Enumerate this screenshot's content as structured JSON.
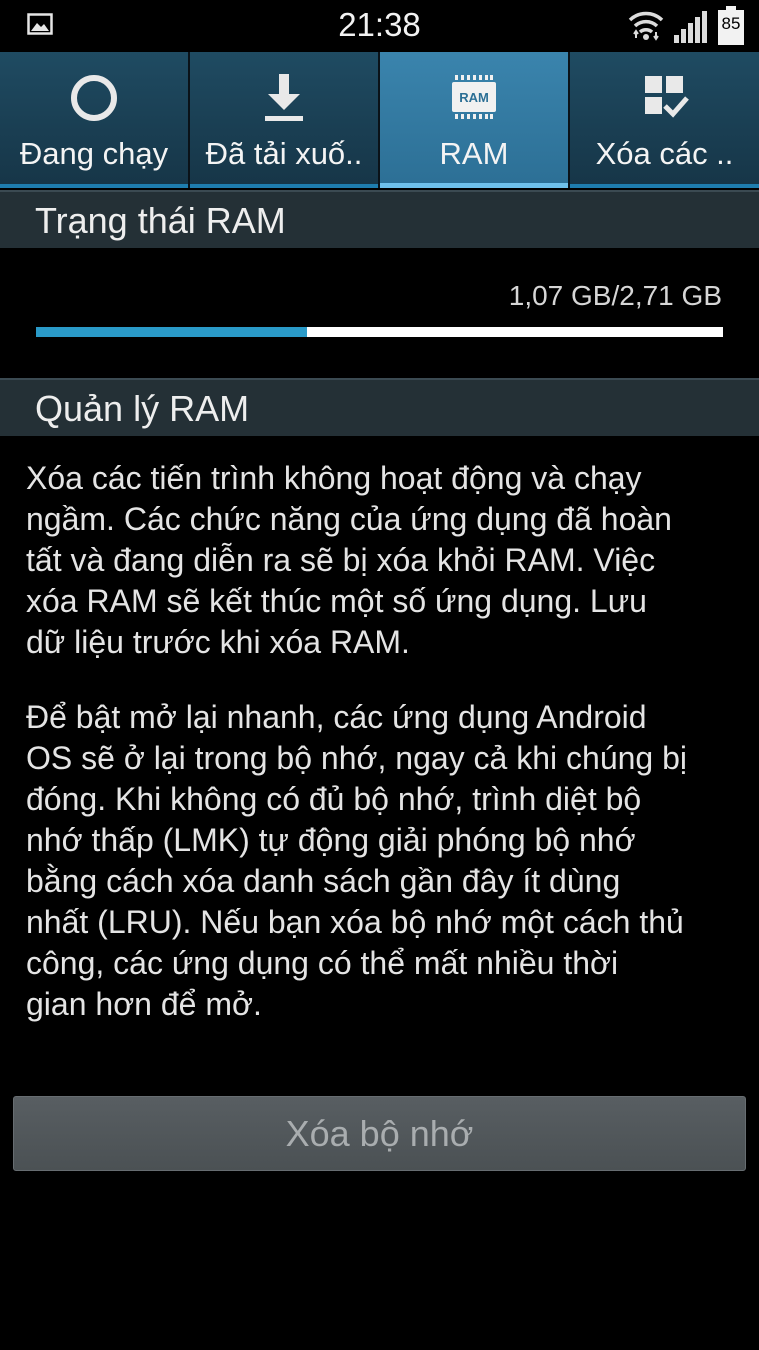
{
  "status_bar": {
    "time": "21:38",
    "battery_level": "85",
    "icons": [
      "gallery-icon",
      "wifi-icon",
      "signal-icon",
      "battery-icon"
    ]
  },
  "tabs": [
    {
      "label": "Đang chạy",
      "icon": "progress-ring-icon",
      "active": false
    },
    {
      "label": "Đã tải xuố..",
      "icon": "download-icon",
      "active": false
    },
    {
      "label": "RAM",
      "icon": "ram-chip-icon",
      "active": true
    },
    {
      "label": "Xóa các ..",
      "icon": "clear-check-icon",
      "active": false
    }
  ],
  "ram_status": {
    "title": "Trạng thái RAM",
    "usage_text": "1,07 GB/2,71 GB",
    "used_fraction": 0.395
  },
  "ram_manage": {
    "title": "Quản lý RAM",
    "paragraph_1": "Xóa các tiến trình không hoạt động và chạy\nngầm. Các chức năng của ứng dụng đã hoàn\ntất và đang diễn ra sẽ bị xóa khỏi RAM. Việc\nxóa RAM sẽ kết thúc một số ứng dụng. Lưu\ndữ liệu trước khi xóa RAM.",
    "paragraph_2": "Để bật mở lại nhanh, các ứng dụng Android\nOS sẽ ở lại trong bộ nhớ, ngay cả khi chúng bị\nđóng. Khi không có đủ bộ nhớ, trình diệt bộ\nnhớ thấp (LMK) tự động giải phóng bộ nhớ\nbằng cách xóa danh sách gần đây ít dùng\nnhất (LRU). Nếu bạn xóa bộ nhớ một cách thủ\ncông, các ứng dụng có thể mất nhiều thời\ngian hơn để mở."
  },
  "clear_button": {
    "label": "Xóa bộ nhớ"
  },
  "colors": {
    "tab_active": "#3a84ad",
    "tab_inactive": "#1f4b62",
    "accent": "#2a9ac8",
    "section_header": "#243036",
    "background": "#000000"
  }
}
